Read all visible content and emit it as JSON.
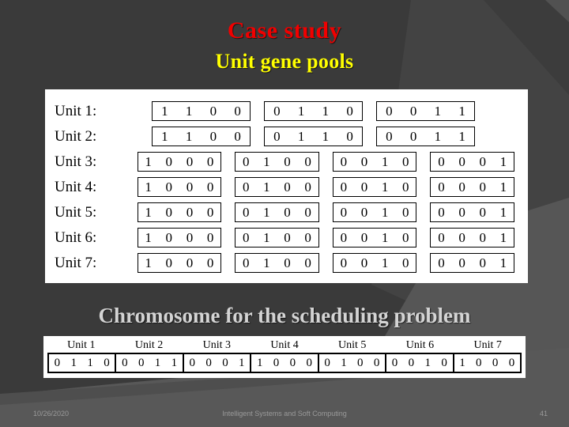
{
  "slide": {
    "title_main": "Case study",
    "title_sub": "Unit gene pools",
    "title_main_color": "#f10000",
    "title_sub_color": "#ffff00",
    "background_color": "#3a3a3a",
    "chromosome_heading": "Chromosome for the scheduling problem",
    "chromosome_heading_color": "#d4d4d4"
  },
  "gene_pools": {
    "rows": [
      {
        "label": "Unit 1:",
        "groups": [
          [
            "1",
            "1",
            "0",
            "0"
          ],
          [
            "0",
            "1",
            "1",
            "0"
          ],
          [
            "0",
            "0",
            "1",
            "1"
          ]
        ]
      },
      {
        "label": "Unit 2:",
        "groups": [
          [
            "1",
            "1",
            "0",
            "0"
          ],
          [
            "0",
            "1",
            "1",
            "0"
          ],
          [
            "0",
            "0",
            "1",
            "1"
          ]
        ]
      },
      {
        "label": "Unit 3:",
        "groups": [
          [
            "1",
            "0",
            "0",
            "0"
          ],
          [
            "0",
            "1",
            "0",
            "0"
          ],
          [
            "0",
            "0",
            "1",
            "0"
          ],
          [
            "0",
            "0",
            "0",
            "1"
          ]
        ]
      },
      {
        "label": "Unit 4:",
        "groups": [
          [
            "1",
            "0",
            "0",
            "0"
          ],
          [
            "0",
            "1",
            "0",
            "0"
          ],
          [
            "0",
            "0",
            "1",
            "0"
          ],
          [
            "0",
            "0",
            "0",
            "1"
          ]
        ]
      },
      {
        "label": "Unit 5:",
        "groups": [
          [
            "1",
            "0",
            "0",
            "0"
          ],
          [
            "0",
            "1",
            "0",
            "0"
          ],
          [
            "0",
            "0",
            "1",
            "0"
          ],
          [
            "0",
            "0",
            "0",
            "1"
          ]
        ]
      },
      {
        "label": "Unit 6:",
        "groups": [
          [
            "1",
            "0",
            "0",
            "0"
          ],
          [
            "0",
            "1",
            "0",
            "0"
          ],
          [
            "0",
            "0",
            "1",
            "0"
          ],
          [
            "0",
            "0",
            "0",
            "1"
          ]
        ]
      },
      {
        "label": "Unit 7:",
        "groups": [
          [
            "1",
            "0",
            "0",
            "0"
          ],
          [
            "0",
            "1",
            "0",
            "0"
          ],
          [
            "0",
            "0",
            "1",
            "0"
          ],
          [
            "0",
            "0",
            "0",
            "1"
          ]
        ]
      }
    ]
  },
  "chromosome": {
    "headers": [
      "Unit 1",
      "Unit 2",
      "Unit 3",
      "Unit 4",
      "Unit 5",
      "Unit 6",
      "Unit 7"
    ],
    "cells": [
      [
        "0",
        "1",
        "1",
        "0"
      ],
      [
        "0",
        "0",
        "1",
        "1"
      ],
      [
        "0",
        "0",
        "0",
        "1"
      ],
      [
        "1",
        "0",
        "0",
        "0"
      ],
      [
        "0",
        "1",
        "0",
        "0"
      ],
      [
        "0",
        "0",
        "1",
        "0"
      ],
      [
        "1",
        "0",
        "0",
        "0"
      ]
    ]
  },
  "footer": {
    "date": "10/26/2020",
    "center": "Intelligent Systems and Soft Computing",
    "page": "41"
  }
}
